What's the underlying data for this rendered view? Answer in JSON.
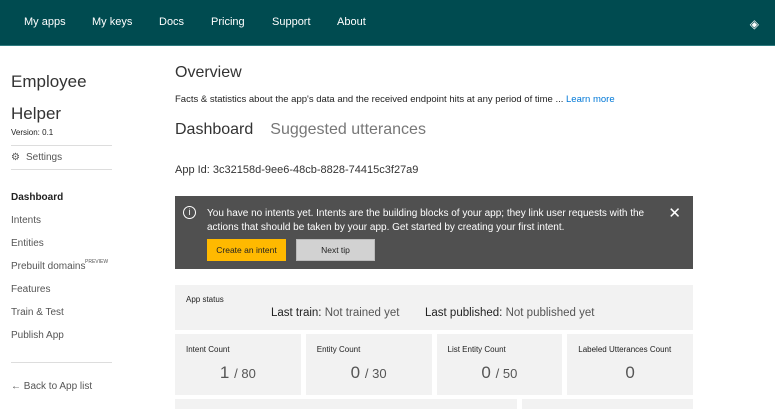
{
  "topnav": {
    "items": [
      "My apps",
      "My keys",
      "Docs",
      "Pricing",
      "Support",
      "About"
    ],
    "icon": "graduation-cap-icon"
  },
  "sidebar": {
    "app_name_line1": "Employee",
    "app_name_line2": "Helper",
    "version": "Version:  0.1",
    "settings": "Settings",
    "items": [
      "Dashboard",
      "Intents",
      "Entities",
      "Prebuilt domains",
      "Features",
      "Train & Test",
      "Publish App"
    ],
    "preview_badge": "PREVIEW",
    "back": "Back to App list"
  },
  "main": {
    "title": "Overview",
    "description": "Facts & statistics about the app's data and the received endpoint hits at any period of time ... ",
    "learn_more": "Learn more",
    "tabs": [
      "Dashboard",
      "Suggested utterances"
    ],
    "app_id": "App Id: 3c32158d-9ee6-48cb-8828-74415c3f27a9",
    "notice": {
      "message": "You have no intents yet. Intents are the building blocks of your app; they link user requests with the actions that should be taken by your app. Get started by creating your first intent.",
      "create": "Create an intent",
      "next": "Next tip"
    },
    "status": {
      "label": "App status",
      "train_label": "Last train:",
      "train_value": "Not trained yet",
      "pub_label": "Last published:",
      "pub_value": "Not published yet"
    },
    "cards": [
      {
        "label": "Intent Count",
        "value": "1",
        "max": "/ 80"
      },
      {
        "label": "Entity Count",
        "value": "0",
        "max": "/ 30"
      },
      {
        "label": "List Entity Count",
        "value": "0",
        "max": "/ 50"
      },
      {
        "label": "Labeled Utterances Count",
        "value": "0",
        "max": ""
      }
    ]
  },
  "colors": {
    "header": "#004b50",
    "accent": "#ffb900",
    "link": "#0078d7"
  }
}
